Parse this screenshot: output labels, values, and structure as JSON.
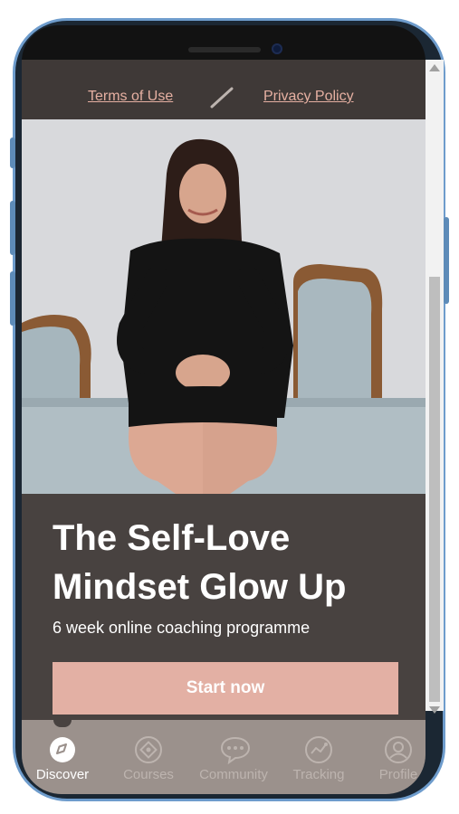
{
  "header": {
    "terms_label": "Terms of Use",
    "privacy_label": "Privacy Policy"
  },
  "hero": {
    "image_alt": "Coach seated on vintage sofa"
  },
  "promo": {
    "title_line1": "The Self-Love",
    "title_line2": "Mindset Glow Up",
    "subtitle": "6 week online coaching programme",
    "cta_label": "Start now"
  },
  "tabs": [
    {
      "label": "Discover",
      "icon": "compass-icon",
      "active": true
    },
    {
      "label": "Courses",
      "icon": "courses-icon",
      "active": false
    },
    {
      "label": "Community",
      "icon": "chat-bubble-icon",
      "active": false
    },
    {
      "label": "Tracking",
      "icon": "tracking-icon",
      "active": false
    },
    {
      "label": "Profile",
      "icon": "profile-icon",
      "active": false
    }
  ],
  "colors": {
    "accent": "#e3b0a4",
    "background": "#484240",
    "tabbar": "#9b918c",
    "frame": "#6e9ccc"
  }
}
